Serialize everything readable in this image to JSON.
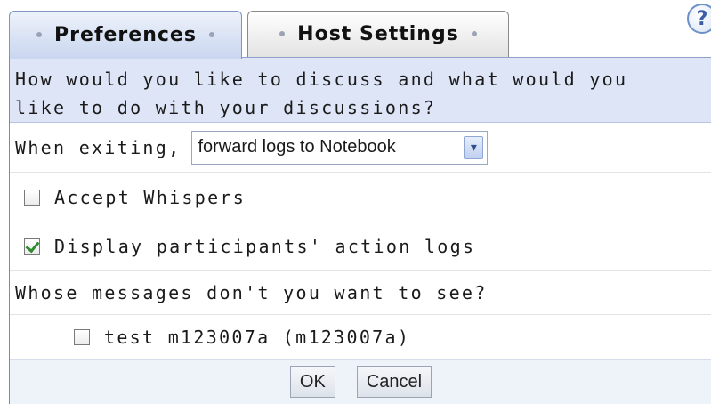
{
  "tabs": [
    {
      "label": "Preferences",
      "active": true
    },
    {
      "label": "Host Settings",
      "active": false
    }
  ],
  "help_icon": "?",
  "question": "How would you like to discuss and what would you\nlike to do with your discussions?",
  "exiting": {
    "label": "When exiting,",
    "selected": "forward logs to Notebook"
  },
  "options": {
    "accept_whispers": {
      "label": "Accept Whispers",
      "checked": false
    },
    "display_action_logs": {
      "label": "Display participants' action logs",
      "checked": true
    }
  },
  "whose_heading": "Whose messages don't you want to see?",
  "participants": [
    {
      "label": "test m123007a (m123007a)",
      "checked": false
    }
  ],
  "buttons": {
    "ok": "OK",
    "cancel": "Cancel"
  },
  "colors": {
    "header_bg": "#dde5f6",
    "footer_bg": "#eef2f9",
    "check_green": "#2e8b2e",
    "help_blue": "#3a5fa7"
  }
}
